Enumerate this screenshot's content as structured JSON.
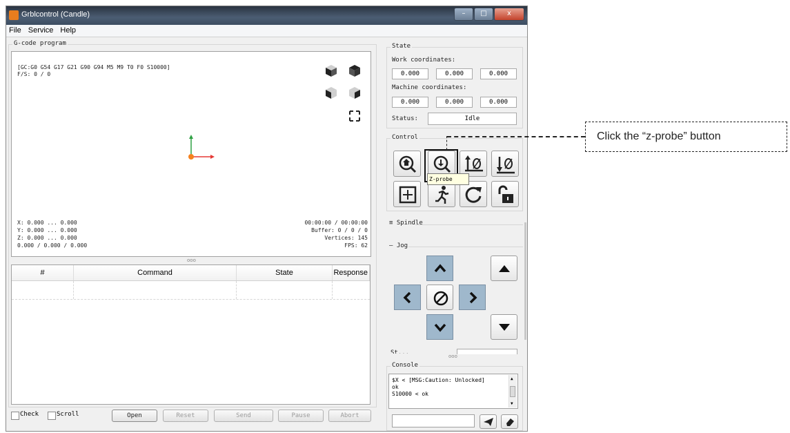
{
  "window": {
    "title": "Grblcontrol (Candle)",
    "buttons": {
      "minimize": "–",
      "maximize": "□",
      "close": "x"
    }
  },
  "menu": [
    "File",
    "Service",
    "Help"
  ],
  "gcode": {
    "group_title": "G-code program",
    "status_lines": [
      "[GC:G0 G54 G17 G21 G90 G94 M5 M9 T0 F0 S10000]",
      "F/S: 0 / 0"
    ],
    "coords": [
      "X: 0.000 ... 0.000",
      "Y: 0.000 ... 0.000",
      "Z: 0.000 ... 0.000",
      "0.000 / 0.000 / 0.000"
    ],
    "stats": [
      "00:00:00 / 00:00:00",
      "Buffer: 0 / 0 / 0",
      "Vertices: 145",
      "FPS: 62"
    ],
    "splitter": "ooo"
  },
  "table": {
    "headers": [
      "#",
      "Command",
      "State",
      "Response"
    ]
  },
  "bottom": {
    "check_label": "Check",
    "scroll_label": "Scroll",
    "buttons": [
      "Open",
      "Reset",
      "Send",
      "Pause",
      "Abort"
    ]
  },
  "state": {
    "group_title": "State",
    "work_label": "Work coordinates:",
    "work": [
      "0.000",
      "0.000",
      "0.000"
    ],
    "machine_label": "Machine coordinates:",
    "machine": [
      "0.000",
      "0.000",
      "0.000"
    ],
    "status_label": "Status:",
    "status_value": "Idle"
  },
  "control": {
    "group_title": "Control",
    "tooltip": "Z-probe"
  },
  "spindle": {
    "label": "Spindle"
  },
  "jog": {
    "label": "Jog",
    "step_label": "St...",
    "splitter": "ooo"
  },
  "console": {
    "group_title": "Console",
    "lines": [
      "$X < [MSG:Caution: Unlocked]",
      "ok",
      "S10000 < ok"
    ],
    "input_placeholder": ""
  },
  "annotation": {
    "text": "Click the “z-probe” button"
  },
  "colors": {
    "accent": "#9fb8cc",
    "titlebar": "#3c4d61"
  }
}
